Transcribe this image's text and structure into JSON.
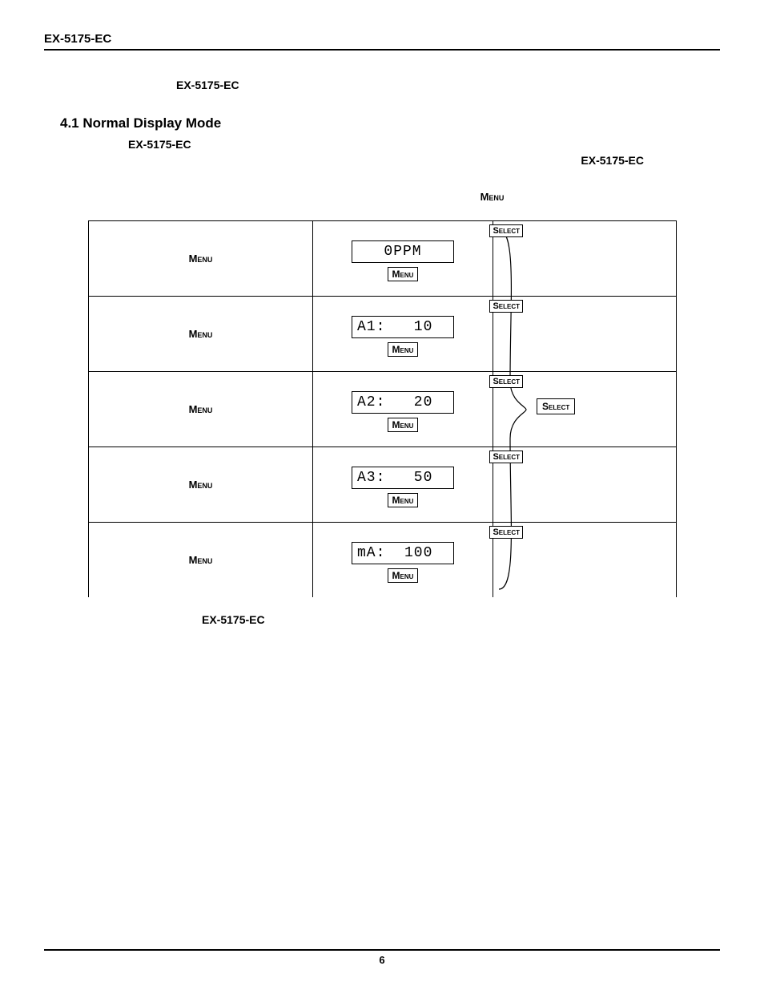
{
  "header": {
    "doc_id": "EX-5175-EC"
  },
  "refs": {
    "model_ref_1": "EX-5175-EC",
    "section_heading": "4.1 Normal Display Mode",
    "sub_ref": "EX-5175-EC",
    "right_ref": "EX-5175-EC",
    "menu_ref": "Menu",
    "caption_ref": "EX-5175-EC"
  },
  "rows": [
    {
      "left": "Menu",
      "lcd": "0PPM",
      "lcd_center": true,
      "below": "Menu",
      "select": "Select"
    },
    {
      "left": "Menu",
      "lcd": "A1:   10",
      "lcd_center": false,
      "below": "Menu",
      "select": "Select"
    },
    {
      "left": "Menu",
      "lcd": "A2:   20",
      "lcd_center": false,
      "below": "Menu",
      "select": "Select"
    },
    {
      "left": "Menu",
      "lcd": "A3:   50",
      "lcd_center": false,
      "below": "Menu",
      "select": "Select"
    },
    {
      "left": "Menu",
      "lcd": "mA:  100",
      "lcd_center": false,
      "below": "Menu",
      "select": "Select"
    }
  ],
  "side_select": "Select",
  "footer": {
    "page": "6"
  }
}
